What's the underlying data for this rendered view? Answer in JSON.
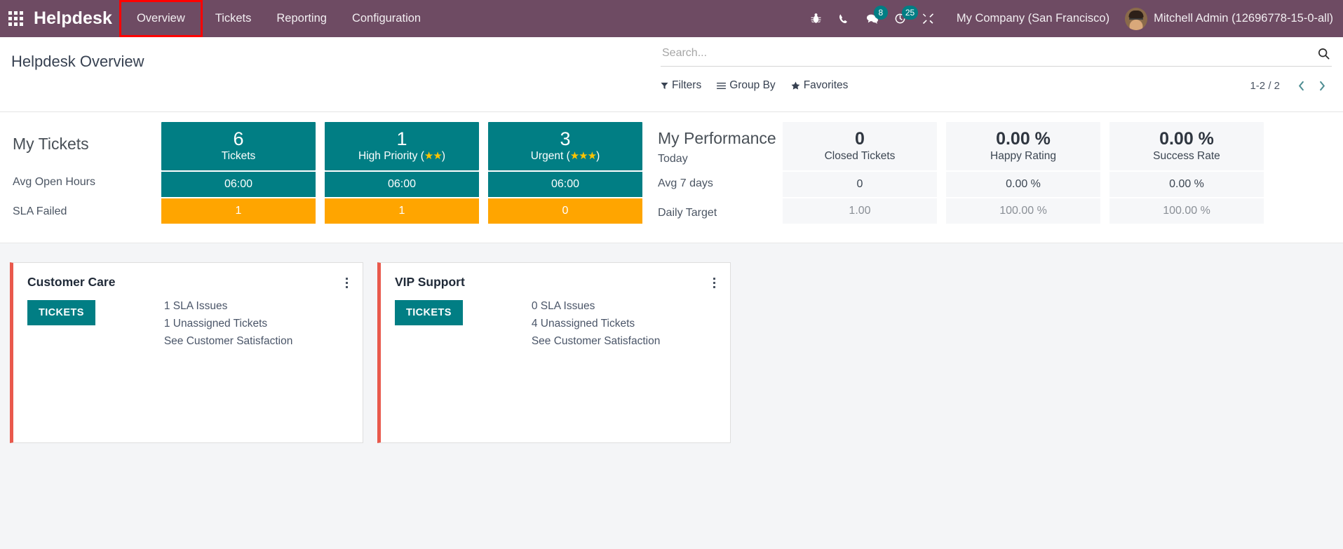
{
  "navbar": {
    "apps_icon": "grid-apps-icon",
    "brand": "Helpdesk",
    "menu_items": [
      {
        "label": "Overview",
        "active": true
      },
      {
        "label": "Tickets",
        "active": false
      },
      {
        "label": "Reporting",
        "active": false
      },
      {
        "label": "Configuration",
        "active": false
      }
    ],
    "icons": [
      {
        "name": "bug-icon",
        "badge": null
      },
      {
        "name": "phone-icon",
        "badge": null
      },
      {
        "name": "messages-icon",
        "badge": "8"
      },
      {
        "name": "activities-clock-icon",
        "badge": "25"
      },
      {
        "name": "tools-icon",
        "badge": null
      }
    ],
    "company": "My Company (San Francisco)",
    "user": "Mitchell Admin (12696778-15-0-all)",
    "avatar_name": "user-avatar"
  },
  "control_panel": {
    "title": "Helpdesk Overview",
    "search": {
      "placeholder": "Search...",
      "value": ""
    },
    "filters": [
      {
        "label": "Filters",
        "icon": "filter-icon"
      },
      {
        "label": "Group By",
        "icon": "group-by-icon"
      },
      {
        "label": "Favorites",
        "icon": "star-icon"
      }
    ],
    "pager": {
      "range": "1-2 / 2",
      "prev_icon": "chevron-left-icon",
      "next_icon": "chevron-right-icon"
    }
  },
  "my_tickets": {
    "title": "My Tickets",
    "row_labels": [
      "Avg Open Hours",
      "SLA Failed"
    ],
    "columns": [
      {
        "value": "6",
        "label": "Tickets",
        "stars": 0,
        "avg_open_hours": "06:00",
        "sla_failed": "1"
      },
      {
        "value": "1",
        "label": "High Priority",
        "stars": 2,
        "avg_open_hours": "06:00",
        "sla_failed": "1"
      },
      {
        "value": "3",
        "label": "Urgent",
        "stars": 3,
        "avg_open_hours": "06:00",
        "sla_failed": "0"
      }
    ]
  },
  "my_performance": {
    "title": "My Performance",
    "row_labels": [
      "Today",
      "Avg 7 days",
      "Daily Target"
    ],
    "columns": [
      {
        "value": "0",
        "label": "Closed Tickets",
        "avg_7_days": "0",
        "daily_target": "1.00"
      },
      {
        "value": "0.00 %",
        "label": "Happy Rating",
        "avg_7_days": "0.00 %",
        "daily_target": "100.00 %"
      },
      {
        "value": "0.00 %",
        "label": "Success Rate",
        "avg_7_days": "0.00 %",
        "daily_target": "100.00 %"
      }
    ]
  },
  "kanban_cards": [
    {
      "title": "Customer Care",
      "tickets_button": "TICKETS",
      "links": [
        "1 SLA Issues",
        "1 Unassigned Tickets",
        "See Customer Satisfaction"
      ],
      "menu_icon": "kebab-menu-icon",
      "stripe_color": "#E9594C"
    },
    {
      "title": "VIP Support",
      "tickets_button": "TICKETS",
      "links": [
        "0 SLA Issues",
        "4 Unassigned Tickets",
        "See Customer Satisfaction"
      ],
      "menu_icon": "kebab-menu-icon",
      "stripe_color": "#E9594C"
    }
  ],
  "colors": {
    "navbar_bg": "#6E4B63",
    "teal": "#017E84",
    "orange": "#FFA500",
    "star_gold": "#FFC400",
    "highlight_box": "#FF0000",
    "kanban_bg": "#F4F5F7",
    "grey_tile": "#F6F7F9"
  }
}
